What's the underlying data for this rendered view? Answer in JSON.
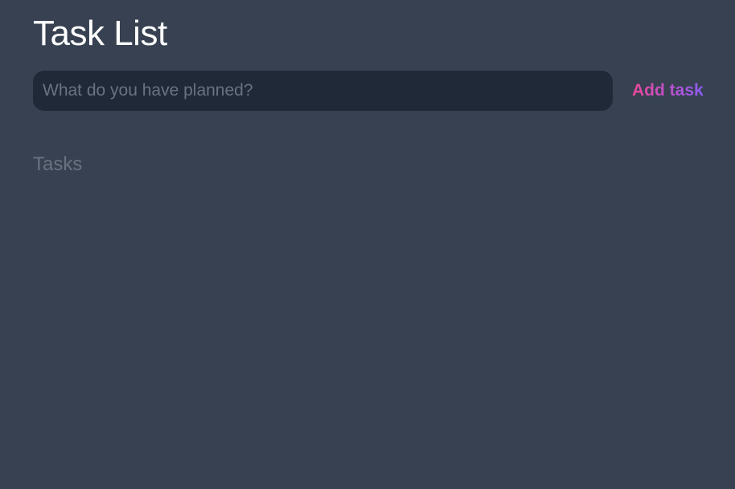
{
  "header": {
    "title": "Task List"
  },
  "new_task": {
    "value": "",
    "placeholder": "What do you have planned?",
    "add_label": "Add task"
  },
  "tasks": {
    "heading": "Tasks",
    "items": []
  },
  "colors": {
    "background": "#374151",
    "input_background": "#1f2937",
    "title": "#ffffff",
    "muted_text": "#6b7280",
    "accent_gradient_start": "#ec4899",
    "accent_gradient_end": "#8b5cf6"
  }
}
